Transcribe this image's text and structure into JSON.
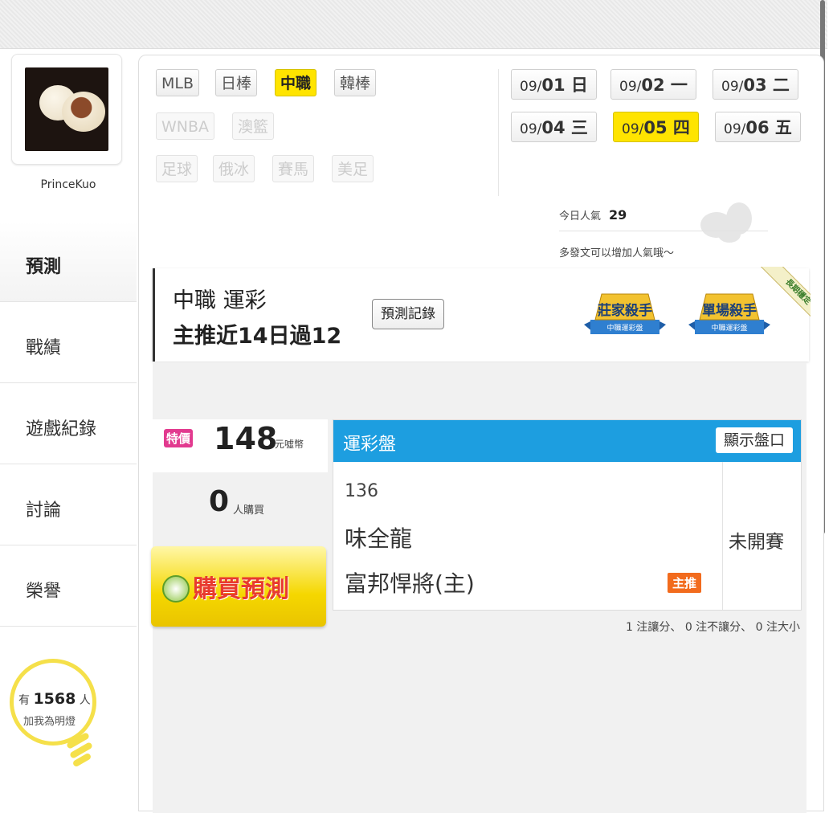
{
  "user": {
    "name": "PrinceKuo"
  },
  "sidebar": {
    "items": [
      {
        "label": "預測"
      },
      {
        "label": "戰績"
      },
      {
        "label": "遊戲紀錄"
      },
      {
        "label": "討論"
      },
      {
        "label": "榮譽"
      }
    ]
  },
  "fans": {
    "prefix": "有",
    "count": "1568",
    "suffix": "人",
    "caption": "加我為明燈"
  },
  "leagues": [
    {
      "label": "MLB"
    },
    {
      "label": "日棒"
    },
    {
      "label": "中職",
      "active": true
    },
    {
      "label": "韓棒"
    },
    {
      "label": "WNBA",
      "disabled": true
    },
    {
      "label": "澳籃",
      "disabled": true
    },
    {
      "label": "足球",
      "disabled": true
    },
    {
      "label": "俄冰",
      "disabled": true
    },
    {
      "label": "賽馬",
      "disabled": true
    },
    {
      "label": "美足",
      "disabled": true
    }
  ],
  "dates": [
    {
      "month": "09/",
      "day": "01 日"
    },
    {
      "month": "09/",
      "day": "02 一"
    },
    {
      "month": "09/",
      "day": "03 二"
    },
    {
      "month": "09/",
      "day": "04 三"
    },
    {
      "month": "09/",
      "day": "05 四",
      "active": true
    },
    {
      "month": "09/",
      "day": "06 五"
    }
  ],
  "popularity": {
    "label": "今日人氣",
    "value": "29",
    "note": "多發文可以增加人氣哦～"
  },
  "header": {
    "line1": "中職 運彩",
    "line2": "主推近14日過12",
    "record_button": "預測記錄",
    "badge1": {
      "title": "莊家殺手",
      "sub": "中職運彩盤"
    },
    "badge2": {
      "title": "單場殺手",
      "sub": "中職運彩盤"
    },
    "ribbon": "長期穩定"
  },
  "price": {
    "tag": "特價",
    "amount": "148",
    "unit": "元噓幣"
  },
  "buyers": {
    "count": "0",
    "unit": "人購買"
  },
  "buy_button": {
    "label": "購買預測"
  },
  "odds": {
    "title": "運彩盤",
    "show_button": "顯示盤口",
    "game_number": "136",
    "team_away": "味全龍",
    "team_home": "富邦悍將(主)",
    "status": "未開賽",
    "main_pick_tag": "主推"
  },
  "summary": "1 注讓分、 0 注不讓分、 0 注大小",
  "colors": {
    "accent_yellow": "#ffe400",
    "odds_header": "#1d9ee0",
    "hot_tag": "#e23a8f",
    "main_tag": "#f26b1d"
  }
}
